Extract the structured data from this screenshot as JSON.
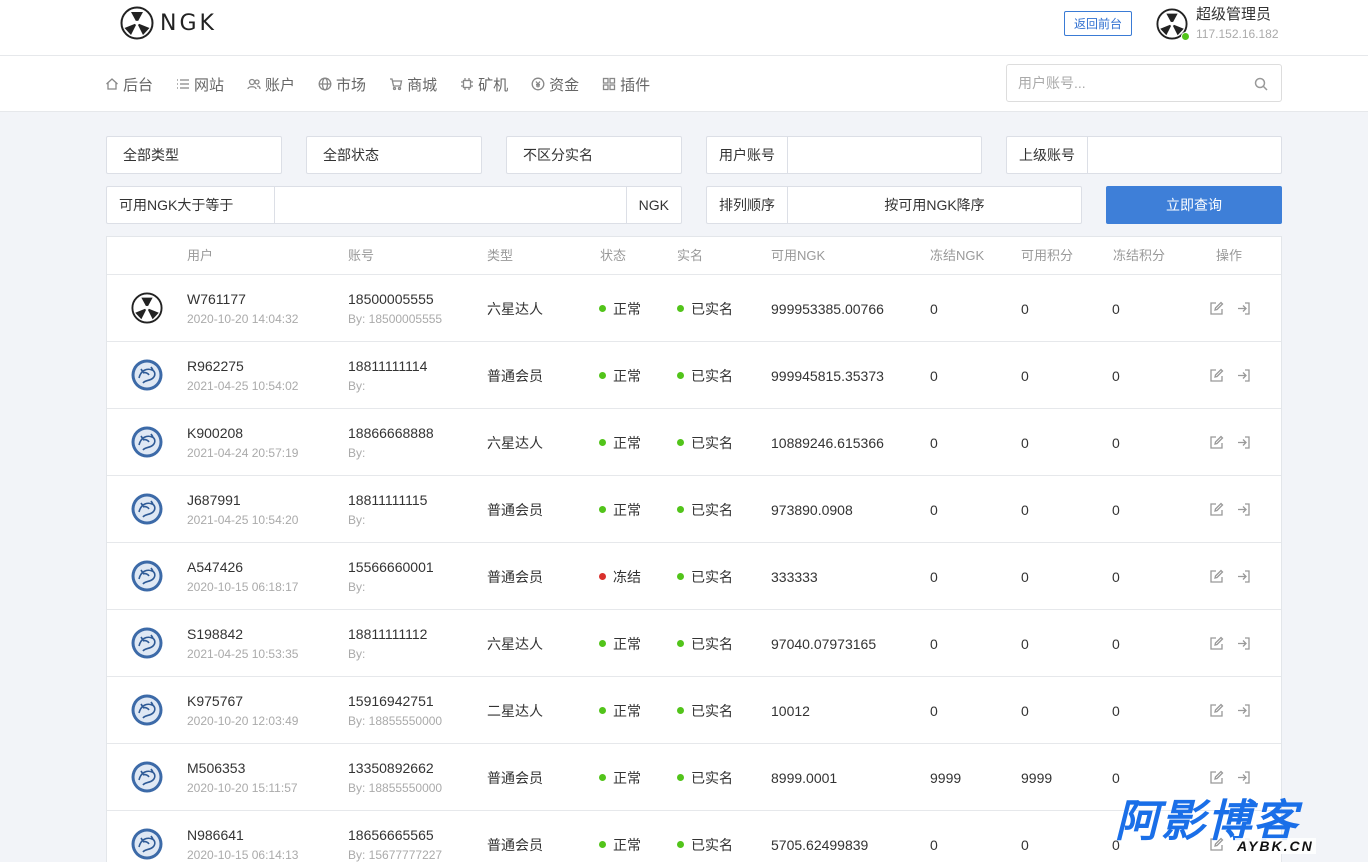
{
  "header": {
    "logo_text": "NGK",
    "front_button": "返回前台",
    "admin_name": "超级管理员",
    "admin_ip": "117.152.16.182"
  },
  "nav": {
    "items": [
      {
        "label": "后台",
        "icon": "home-icon"
      },
      {
        "label": "网站",
        "icon": "list-icon"
      },
      {
        "label": "账户",
        "icon": "users-icon"
      },
      {
        "label": "市场",
        "icon": "globe-icon"
      },
      {
        "label": "商城",
        "icon": "cart-icon"
      },
      {
        "label": "矿机",
        "icon": "chip-icon"
      },
      {
        "label": "资金",
        "icon": "coin-icon"
      },
      {
        "label": "插件",
        "icon": "grid-icon"
      }
    ],
    "search_placeholder": "用户账号..."
  },
  "filters": {
    "type": "全部类型",
    "status": "全部状态",
    "realname": "不区分实名",
    "account_label": "用户账号",
    "parent_label": "上级账号",
    "ngk_label": "可用NGK大于等于",
    "ngk_unit": "NGK",
    "sort_label": "排列顺序",
    "sort_value": "按可用NGK降序",
    "query_button": "立即查询"
  },
  "table": {
    "headers": {
      "user": "用户",
      "account": "账号",
      "type": "类型",
      "status": "状态",
      "realname": "实名",
      "ngk": "可用NGK",
      "frozen_ngk": "冻结NGK",
      "points": "可用积分",
      "frozen_points": "冻结积分",
      "ops": "操作"
    },
    "rows": [
      {
        "avatar": "ngk",
        "user": "W761177",
        "time": "2020-10-20 14:04:32",
        "account": "18500005555",
        "by": "By: 18500005555",
        "type": "六星达人",
        "status": "正常",
        "status_color": "#52c41a",
        "realname": "已实名",
        "ngk": "999953385.00766",
        "frozen_ngk": "0",
        "points": "0",
        "frozen_points": "0"
      },
      {
        "avatar": "blue",
        "user": "R962275",
        "time": "2021-04-25 10:54:02",
        "account": "18811111114",
        "by": "By:",
        "type": "普通会员",
        "status": "正常",
        "status_color": "#52c41a",
        "realname": "已实名",
        "ngk": "999945815.35373",
        "frozen_ngk": "0",
        "points": "0",
        "frozen_points": "0"
      },
      {
        "avatar": "blue",
        "user": "K900208",
        "time": "2021-04-24 20:57:19",
        "account": "18866668888",
        "by": "By:",
        "type": "六星达人",
        "status": "正常",
        "status_color": "#52c41a",
        "realname": "已实名",
        "ngk": "10889246.615366",
        "frozen_ngk": "0",
        "points": "0",
        "frozen_points": "0"
      },
      {
        "avatar": "blue",
        "user": "J687991",
        "time": "2021-04-25 10:54:20",
        "account": "18811111115",
        "by": "By:",
        "type": "普通会员",
        "status": "正常",
        "status_color": "#52c41a",
        "realname": "已实名",
        "ngk": "973890.0908",
        "frozen_ngk": "0",
        "points": "0",
        "frozen_points": "0"
      },
      {
        "avatar": "blue",
        "user": "A547426",
        "time": "2020-10-15 06:18:17",
        "account": "15566660001",
        "by": "By:",
        "type": "普通会员",
        "status": "冻结",
        "status_color": "#d9302c",
        "realname": "已实名",
        "ngk": "333333",
        "frozen_ngk": "0",
        "points": "0",
        "frozen_points": "0"
      },
      {
        "avatar": "blue",
        "user": "S198842",
        "time": "2021-04-25 10:53:35",
        "account": "18811111112",
        "by": "By:",
        "type": "六星达人",
        "status": "正常",
        "status_color": "#52c41a",
        "realname": "已实名",
        "ngk": "97040.07973165",
        "frozen_ngk": "0",
        "points": "0",
        "frozen_points": "0"
      },
      {
        "avatar": "blue",
        "user": "K975767",
        "time": "2020-10-20 12:03:49",
        "account": "15916942751",
        "by": "By: 18855550000",
        "type": "二星达人",
        "status": "正常",
        "status_color": "#52c41a",
        "realname": "已实名",
        "ngk": "10012",
        "frozen_ngk": "0",
        "points": "0",
        "frozen_points": "0"
      },
      {
        "avatar": "blue",
        "user": "M506353",
        "time": "2020-10-20 15:11:57",
        "account": "13350892662",
        "by": "By: 18855550000",
        "type": "普通会员",
        "status": "正常",
        "status_color": "#52c41a",
        "realname": "已实名",
        "ngk": "8999.0001",
        "frozen_ngk": "9999",
        "points": "9999",
        "frozen_points": "0"
      },
      {
        "avatar": "blue",
        "user": "N986641",
        "time": "2020-10-15 06:14:13",
        "account": "18656665565",
        "by": "By: 15677777227",
        "type": "普通会员",
        "status": "正常",
        "status_color": "#52c41a",
        "realname": "已实名",
        "ngk": "5705.62499839",
        "frozen_ngk": "0",
        "points": "0",
        "frozen_points": "0"
      }
    ]
  },
  "watermark": {
    "big": "阿影博客",
    "small": "AYBK.CN"
  }
}
